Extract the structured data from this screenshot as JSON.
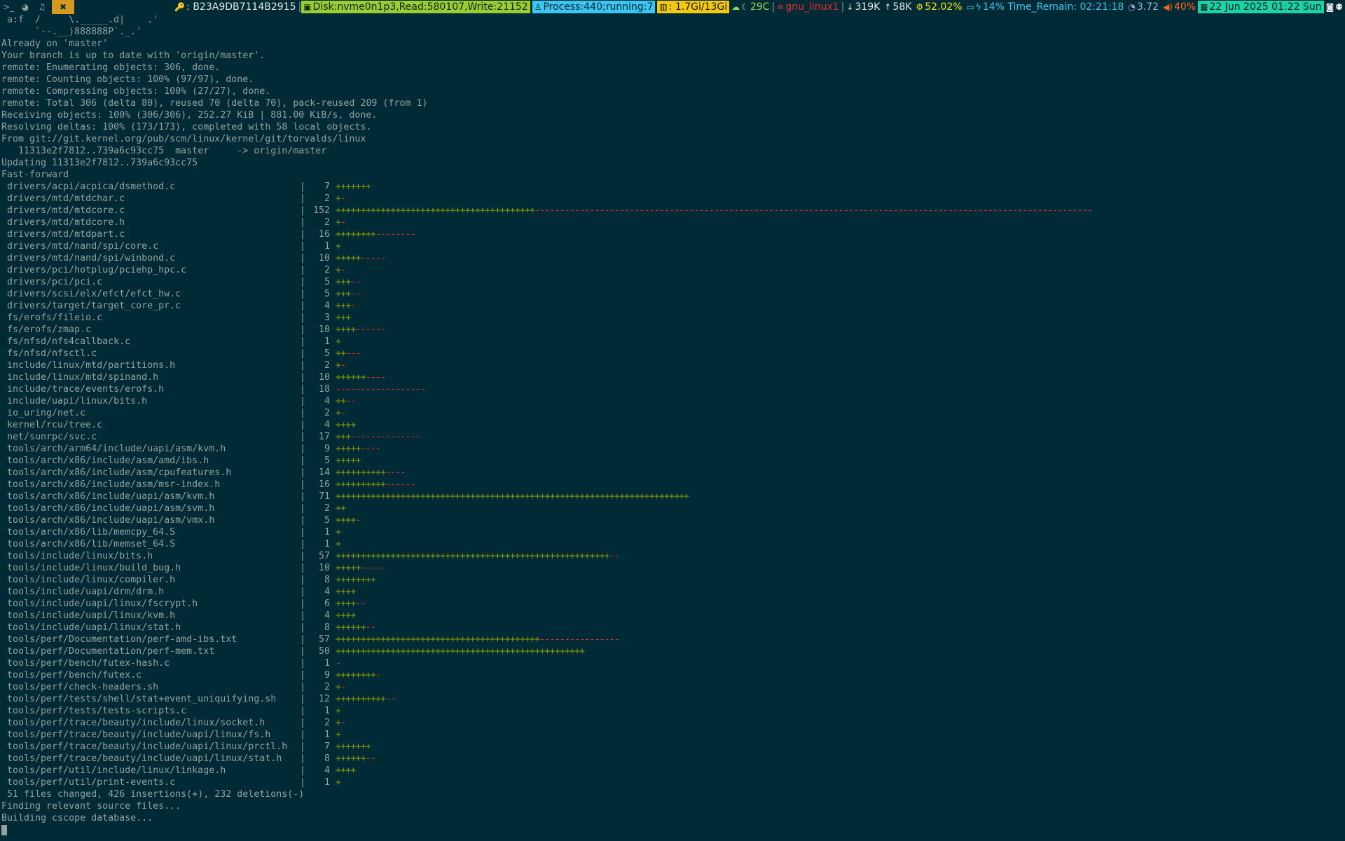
{
  "statusbar": {
    "workspaces": [
      {
        "icon": "terminal-icon",
        "glyph": ">_",
        "active": false
      },
      {
        "icon": "globe-icon",
        "glyph": "◕",
        "active": false
      },
      {
        "icon": "bell-icon",
        "glyph": "♫",
        "active": false
      },
      {
        "icon": "tools-icon",
        "glyph": "✖",
        "active": true
      }
    ],
    "segments": {
      "hash": ": B23A9DB7114B2915",
      "disk": "Disk:nvme0n1p3,Read:580107,Write:21152",
      "process": "Process:440;running:7",
      "memory": ": 1.7Gi/13Gi",
      "temp": "29C",
      "net": "gnu_linux1",
      "down": "319K",
      "up": "58K",
      "cpu": "52.02%",
      "battery": "14% Time_Remain: 02:21:18",
      "load": "3.72",
      "volume": "40%",
      "datetime": "22 Jun 2025 01:22 Sun"
    }
  },
  "terminal": {
    "header_lines": [
      " a:f  /     \\._____.d|    .'",
      "      `--.__)888888P`._.'",
      "Already on 'master'",
      "Your branch is up to date with 'origin/master'.",
      "remote: Enumerating objects: 306, done.",
      "remote: Counting objects: 100% (97/97), done.",
      "remote: Compressing objects: 100% (27/27), done.",
      "remote: Total 306 (delta 80), reused 70 (delta 70), pack-reused 209 (from 1)",
      "Receiving objects: 100% (306/306), 252.27 KiB | 881.00 KiB/s, done.",
      "Resolving deltas: 100% (173/173), completed with 58 local objects.",
      "From git://git.kernel.org/pub/scm/linux/kernel/git/torvalds/linux",
      "   11313e2f7812..739a6c93cc75  master     -> origin/master",
      "Updating 11313e2f7812..739a6c93cc75",
      "Fast-forward"
    ],
    "diffstat": [
      {
        "file": "drivers/acpi/acpica/dsmethod.c",
        "count": "7",
        "plus": 7,
        "minus": 0
      },
      {
        "file": "drivers/mtd/mtdchar.c",
        "count": "2",
        "plus": 1,
        "minus": 1
      },
      {
        "file": "drivers/mtd/mtdcore.c",
        "count": "152",
        "plus": 40,
        "minus": 112
      },
      {
        "file": "drivers/mtd/mtdcore.h",
        "count": "2",
        "plus": 1,
        "minus": 1
      },
      {
        "file": "drivers/mtd/mtdpart.c",
        "count": "16",
        "plus": 8,
        "minus": 8
      },
      {
        "file": "drivers/mtd/nand/spi/core.c",
        "count": "1",
        "plus": 1,
        "minus": 0
      },
      {
        "file": "drivers/mtd/nand/spi/winbond.c",
        "count": "10",
        "plus": 5,
        "minus": 5
      },
      {
        "file": "drivers/pci/hotplug/pciehp_hpc.c",
        "count": "2",
        "plus": 1,
        "minus": 1
      },
      {
        "file": "drivers/pci/pci.c",
        "count": "5",
        "plus": 3,
        "minus": 2
      },
      {
        "file": "drivers/scsi/elx/efct/efct_hw.c",
        "count": "5",
        "plus": 3,
        "minus": 2
      },
      {
        "file": "drivers/target/target_core_pr.c",
        "count": "4",
        "plus": 3,
        "minus": 1
      },
      {
        "file": "fs/erofs/fileio.c",
        "count": "3",
        "plus": 3,
        "minus": 0
      },
      {
        "file": "fs/erofs/zmap.c",
        "count": "10",
        "plus": 4,
        "minus": 6
      },
      {
        "file": "fs/nfsd/nfs4callback.c",
        "count": "1",
        "plus": 1,
        "minus": 0
      },
      {
        "file": "fs/nfsd/nfsctl.c",
        "count": "5",
        "plus": 2,
        "minus": 3
      },
      {
        "file": "include/linux/mtd/partitions.h",
        "count": "2",
        "plus": 1,
        "minus": 1
      },
      {
        "file": "include/linux/mtd/spinand.h",
        "count": "10",
        "plus": 6,
        "minus": 4
      },
      {
        "file": "include/trace/events/erofs.h",
        "count": "18",
        "plus": 0,
        "minus": 18
      },
      {
        "file": "include/uapi/linux/bits.h",
        "count": "4",
        "plus": 2,
        "minus": 2
      },
      {
        "file": "io_uring/net.c",
        "count": "2",
        "plus": 1,
        "minus": 1
      },
      {
        "file": "kernel/rcu/tree.c",
        "count": "4",
        "plus": 4,
        "minus": 0
      },
      {
        "file": "net/sunrpc/svc.c",
        "count": "17",
        "plus": 3,
        "minus": 14
      },
      {
        "file": "tools/arch/arm64/include/uapi/asm/kvm.h",
        "count": "9",
        "plus": 5,
        "minus": 4
      },
      {
        "file": "tools/arch/x86/include/asm/amd/ibs.h",
        "count": "5",
        "plus": 5,
        "minus": 0
      },
      {
        "file": "tools/arch/x86/include/asm/cpufeatures.h",
        "count": "14",
        "plus": 10,
        "minus": 4
      },
      {
        "file": "tools/arch/x86/include/asm/msr-index.h",
        "count": "16",
        "plus": 10,
        "minus": 6
      },
      {
        "file": "tools/arch/x86/include/uapi/asm/kvm.h",
        "count": "71",
        "plus": 71,
        "minus": 0
      },
      {
        "file": "tools/arch/x86/include/uapi/asm/svm.h",
        "count": "2",
        "plus": 2,
        "minus": 0
      },
      {
        "file": "tools/arch/x86/include/uapi/asm/vmx.h",
        "count": "5",
        "plus": 4,
        "minus": 1
      },
      {
        "file": "tools/arch/x86/lib/memcpy_64.S",
        "count": "1",
        "plus": 1,
        "minus": 0
      },
      {
        "file": "tools/arch/x86/lib/memset_64.S",
        "count": "1",
        "plus": 1,
        "minus": 0
      },
      {
        "file": "tools/include/linux/bits.h",
        "count": "57",
        "plus": 55,
        "minus": 2
      },
      {
        "file": "tools/include/linux/build_bug.h",
        "count": "10",
        "plus": 5,
        "minus": 5
      },
      {
        "file": "tools/include/linux/compiler.h",
        "count": "8",
        "plus": 8,
        "minus": 0
      },
      {
        "file": "tools/include/uapi/drm/drm.h",
        "count": "4",
        "plus": 4,
        "minus": 0
      },
      {
        "file": "tools/include/uapi/linux/fscrypt.h",
        "count": "6",
        "plus": 4,
        "minus": 2
      },
      {
        "file": "tools/include/uapi/linux/kvm.h",
        "count": "4",
        "plus": 4,
        "minus": 0
      },
      {
        "file": "tools/include/uapi/linux/stat.h",
        "count": "8",
        "plus": 6,
        "minus": 2
      },
      {
        "file": "tools/perf/Documentation/perf-amd-ibs.txt",
        "count": "57",
        "plus": 41,
        "minus": 16
      },
      {
        "file": "tools/perf/Documentation/perf-mem.txt",
        "count": "50",
        "plus": 50,
        "minus": 0
      },
      {
        "file": "tools/perf/bench/futex-hash.c",
        "count": "1",
        "plus": 0,
        "minus": 1
      },
      {
        "file": "tools/perf/bench/futex.c",
        "count": "9",
        "plus": 8,
        "minus": 1
      },
      {
        "file": "tools/perf/check-headers.sh",
        "count": "2",
        "plus": 1,
        "minus": 1
      },
      {
        "file": "tools/perf/tests/shell/stat+event_uniquifying.sh",
        "count": "12",
        "plus": 10,
        "minus": 2
      },
      {
        "file": "tools/perf/tests/tests-scripts.c",
        "count": "1",
        "plus": 1,
        "minus": 0
      },
      {
        "file": "tools/perf/trace/beauty/include/linux/socket.h",
        "count": "2",
        "plus": 1,
        "minus": 1
      },
      {
        "file": "tools/perf/trace/beauty/include/uapi/linux/fs.h",
        "count": "1",
        "plus": 1,
        "minus": 0
      },
      {
        "file": "tools/perf/trace/beauty/include/uapi/linux/prctl.h",
        "count": "7",
        "plus": 7,
        "minus": 0
      },
      {
        "file": "tools/perf/trace/beauty/include/uapi/linux/stat.h",
        "count": "8",
        "plus": 6,
        "minus": 2
      },
      {
        "file": "tools/perf/util/include/linux/linkage.h",
        "count": "4",
        "plus": 4,
        "minus": 0
      },
      {
        "file": "tools/perf/util/print-events.c",
        "count": "1",
        "plus": 1,
        "minus": 0
      }
    ],
    "footer_lines": [
      " 51 files changed, 426 insertions(+), 232 deletions(-)",
      "Finding relevant source files...",
      "Building cscope database..."
    ]
  },
  "colors": {
    "background": "#002b36",
    "text": "#93a1a1",
    "plus": "#859900",
    "minus": "#dc322f"
  }
}
